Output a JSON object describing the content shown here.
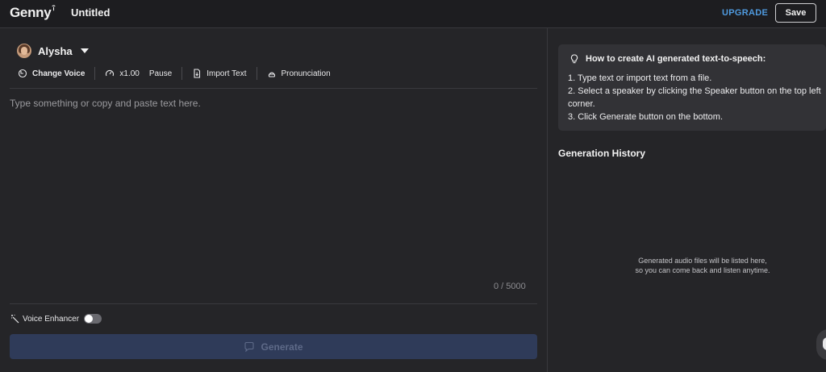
{
  "header": {
    "logo": "Genny",
    "doc_title": "Untitled",
    "upgrade_label": "UPGRADE",
    "save_label": "Save"
  },
  "speaker": {
    "name": "Alysha",
    "icon": "caret-down-icon"
  },
  "toolbar": {
    "change_voice": "Change Voice",
    "speed": "x1.00",
    "pause": "Pause",
    "import_text": "Import Text",
    "pronunciation": "Pronunciation"
  },
  "editor": {
    "placeholder": "Type something or copy and paste text here.",
    "counter": "0 / 5000"
  },
  "enhancer": {
    "label": "Voice Enhancer",
    "enabled": false
  },
  "generate": {
    "label": "Generate"
  },
  "info": {
    "title": "How to create AI generated text-to-speech:",
    "lines": [
      "1. Type text or import text from a file.",
      "2. Select a speaker by clicking the Speaker button on the top left corner.",
      "3. Click Generate button on the bottom."
    ]
  },
  "history": {
    "title": "Generation History",
    "empty_line1": "Generated audio files will be listed here,",
    "empty_line2": "so you can come back and listen anytime."
  },
  "colors": {
    "background": "#252528",
    "topbar": "#1d1d20",
    "accent": "#4f9be0",
    "generate_button": "#2f3b59",
    "card": "#323236"
  }
}
